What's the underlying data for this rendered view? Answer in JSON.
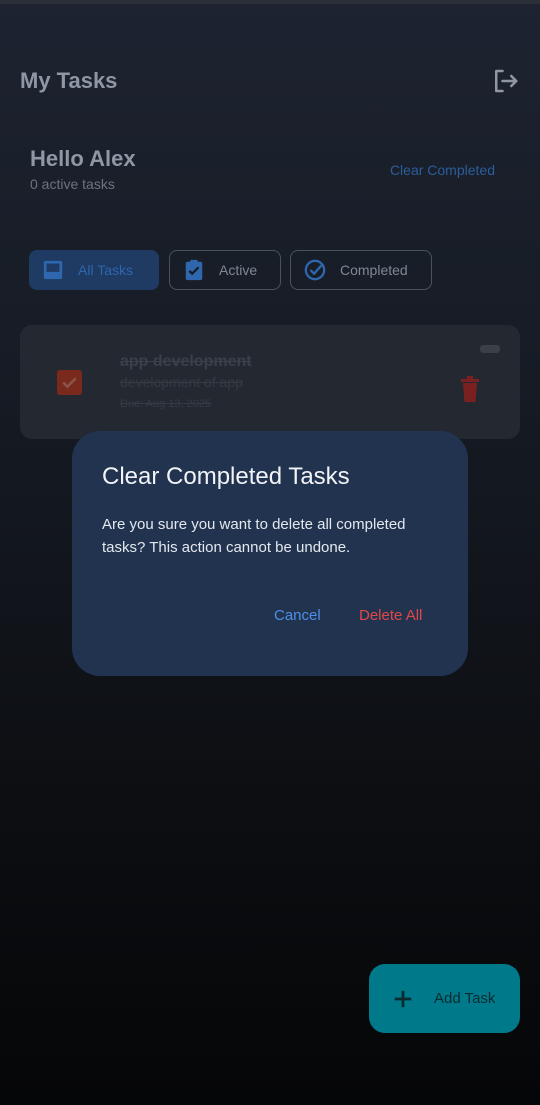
{
  "header": {
    "title": "My Tasks",
    "logout_icon": "logout-icon"
  },
  "greeting": {
    "name": "Hello Alex",
    "subtitle": "0 active tasks"
  },
  "actions": {
    "clear_completed": "Clear Completed"
  },
  "filters": [
    {
      "label": "All Tasks",
      "icon": "inbox-icon",
      "selected": true
    },
    {
      "label": "Active",
      "icon": "clipboard-check-icon",
      "selected": false
    },
    {
      "label": "Completed",
      "icon": "check-circle-icon",
      "selected": false
    }
  ],
  "tasks": [
    {
      "title": "app development",
      "description": "development of app",
      "due": "Due: Aug 13, 2025",
      "completed": true
    }
  ],
  "dialog": {
    "title": "Clear Completed Tasks",
    "message": "Are you sure you want to delete all completed tasks? This action cannot be undone.",
    "cancel_label": "Cancel",
    "confirm_label": "Delete All"
  },
  "fab": {
    "label": "Add Task",
    "icon": "plus-icon"
  },
  "colors": {
    "primary": "#2e67ad",
    "dialog_bg": "#223350",
    "danger": "#e04848",
    "link": "#4d8fe6",
    "fab": "#007a8a"
  }
}
